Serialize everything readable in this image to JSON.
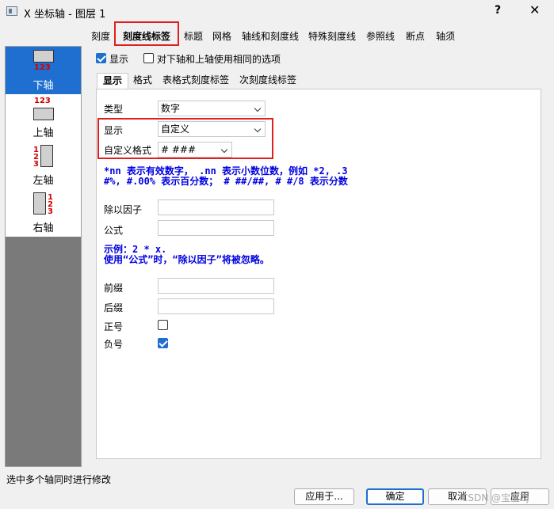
{
  "window": {
    "title": "X 坐标轴 - 图层 1",
    "help_label": "?",
    "close_label": "✕"
  },
  "axes": [
    {
      "label": "下轴",
      "icon": "bottom-axis-icon",
      "nums": "123",
      "selected": true
    },
    {
      "label": "上轴",
      "icon": "top-axis-icon",
      "nums": "123",
      "selected": false
    },
    {
      "label": "左轴",
      "icon": "left-axis-icon",
      "nums": "123",
      "selected": false
    },
    {
      "label": "右轴",
      "icon": "right-axis-icon",
      "nums": "123",
      "selected": false
    }
  ],
  "tabs": [
    "刻度",
    "刻度线标签",
    "标题",
    "网格",
    "轴线和刻度线",
    "特殊刻度线",
    "参照线",
    "断点",
    "轴须"
  ],
  "active_tab": "刻度线标签",
  "options": {
    "show_label": "显示",
    "show_checked": true,
    "same_options_label": "对下轴和上轴使用相同的选项",
    "same_options_checked": false
  },
  "subtabs": [
    "显示",
    "格式",
    "表格式刻度标签",
    "次刻度线标签"
  ],
  "active_subtab": "显示",
  "form": {
    "type_label": "类型",
    "type_value": "数字",
    "display_label": "显示",
    "display_value": "自定义",
    "custom_format_label": "自定义格式",
    "custom_format_value": "# ###",
    "hint_line1": "*nn 表示有效数字， .nn 表示小数位数，例如 *2, .3",
    "hint_line2": "#%, #.00% 表示百分数； # ##/##, # #/8 表示分数",
    "divide_label": "除以因子",
    "divide_value": "",
    "formula_label": "公式",
    "formula_value": "",
    "example_line1": "示例：2 * x.",
    "example_line2": "使用“公式”时，“除以因子”将被忽略。",
    "prefix_label": "前缀",
    "prefix_value": "",
    "suffix_label": "后缀",
    "suffix_value": "",
    "plus_label": "正号",
    "plus_checked": false,
    "minus_label": "负号",
    "minus_checked": true
  },
  "status": "选中多个轴同时进行修改",
  "buttons": {
    "apply_to": "应用于...",
    "ok": "确定",
    "cancel": "取消",
    "apply": "应用"
  },
  "watermark": "CSDN @宝宝Zj",
  "colors": {
    "accent": "#1e6fd0",
    "highlight_red": "#e02020",
    "hint_blue": "#0000e0",
    "axis_number_red": "#d40000"
  }
}
